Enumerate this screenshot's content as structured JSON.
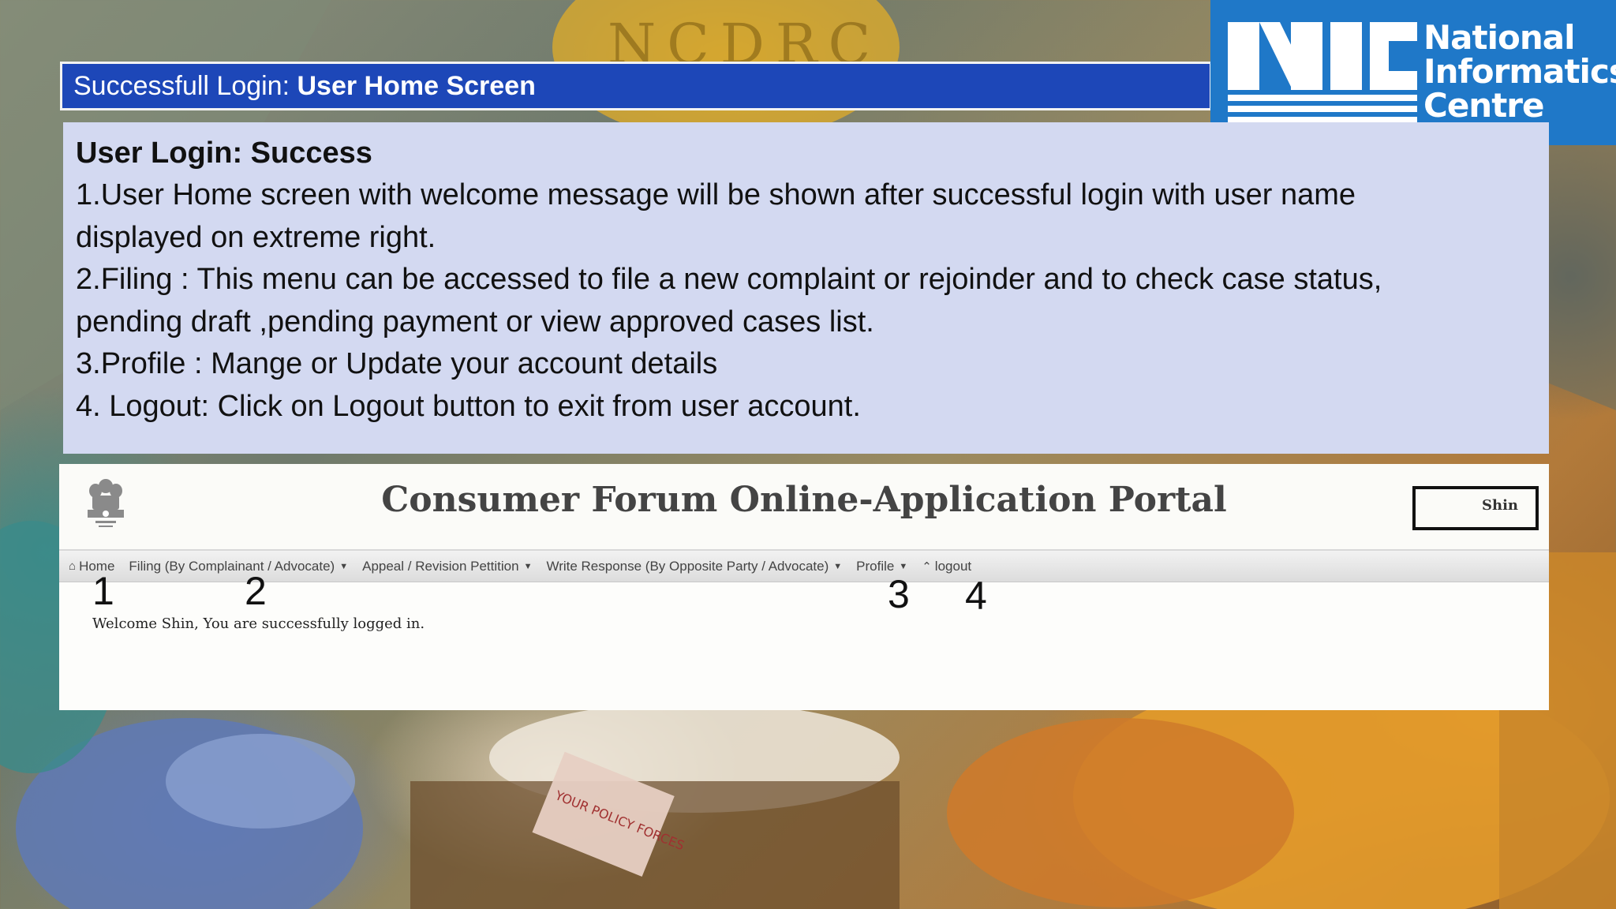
{
  "slide": {
    "title_prefix": "Successfull Login: ",
    "title_emphasis": "User Home Screen"
  },
  "logo": {
    "mark": "NIC",
    "line1": "National",
    "line2": "Informatics",
    "line3": "Centre"
  },
  "background": {
    "watermark_text": "NCDRC",
    "poster_text": "YOUR POLICY FORCES"
  },
  "info": {
    "heading": "User Login: Success",
    "lines": [
      "1.User Home screen with welcome message will be shown after successful login with user name",
      "displayed on extreme right.",
      "2.Filing :  This menu can be accessed to file a new complaint or rejoinder and to check  case status,",
      "pending draft ,pending payment or view approved cases list.",
      "3.Profile : Mange or Update your account details",
      "4. Logout: Click on Logout button to exit from user account."
    ]
  },
  "portal": {
    "title": "Consumer Forum Online-Application Portal",
    "user_name": "Shin",
    "nav": {
      "home": "Home",
      "filing": "Filing (By Complainant / Advocate)",
      "appeal": "Appeal / Revision Pettition",
      "write_response": "Write Response (By Opposite Party / Advocate)",
      "profile": "Profile",
      "logout": "logout"
    },
    "markers": [
      "1",
      "2",
      "3",
      "4"
    ],
    "welcome": "Welcome Shin, You are successfully logged in."
  },
  "colors": {
    "title_bar": "#1d47b8",
    "nic_blue": "#1f78c8",
    "info_panel": "#d3d9f1"
  },
  "icons": {
    "home": "home-icon",
    "caret": "caret-down-icon",
    "logout": "logout-icon",
    "emblem": "state-emblem-icon"
  }
}
